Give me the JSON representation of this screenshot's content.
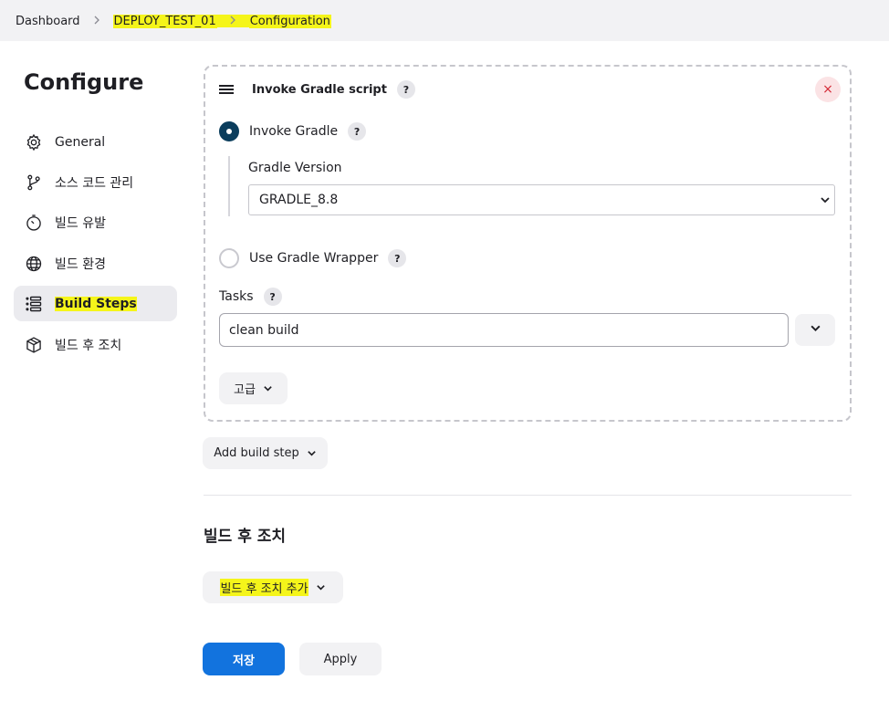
{
  "breadcrumb": {
    "items": [
      "Dashboard",
      "DEPLOY_TEST_01",
      "Configuration"
    ]
  },
  "sidebar": {
    "title": "Configure",
    "items": [
      {
        "label": "General",
        "icon": "gear-icon"
      },
      {
        "label": "소스 코드 관리",
        "icon": "git-branch-icon"
      },
      {
        "label": "빌드 유발",
        "icon": "clock-icon"
      },
      {
        "label": "빌드 환경",
        "icon": "globe-icon"
      },
      {
        "label": "Build Steps",
        "icon": "list-icon",
        "active": true
      },
      {
        "label": "빌드 후 조치",
        "icon": "package-icon"
      }
    ]
  },
  "build_step": {
    "title": "Invoke Gradle script",
    "help": "?",
    "close": "×",
    "invoke_gradle": {
      "label": "Invoke Gradle",
      "selected": true
    },
    "gradle_version_label": "Gradle Version",
    "gradle_version_value": "GRADLE_8.8",
    "use_wrapper": {
      "label": "Use Gradle Wrapper",
      "selected": false
    },
    "tasks_label": "Tasks",
    "tasks_value": "clean build",
    "advanced_label": "고급"
  },
  "add_build_step_label": "Add build step",
  "post_build": {
    "title": "빌드 후 조치",
    "add_label": "빌드 후 조치 추가"
  },
  "actions": {
    "save_label": "저장",
    "apply_label": "Apply"
  },
  "colors": {
    "primary": "#1273de",
    "radio_checked": "#0b3d5c",
    "highlight": "#f5f51a",
    "close": "#d42a36"
  }
}
